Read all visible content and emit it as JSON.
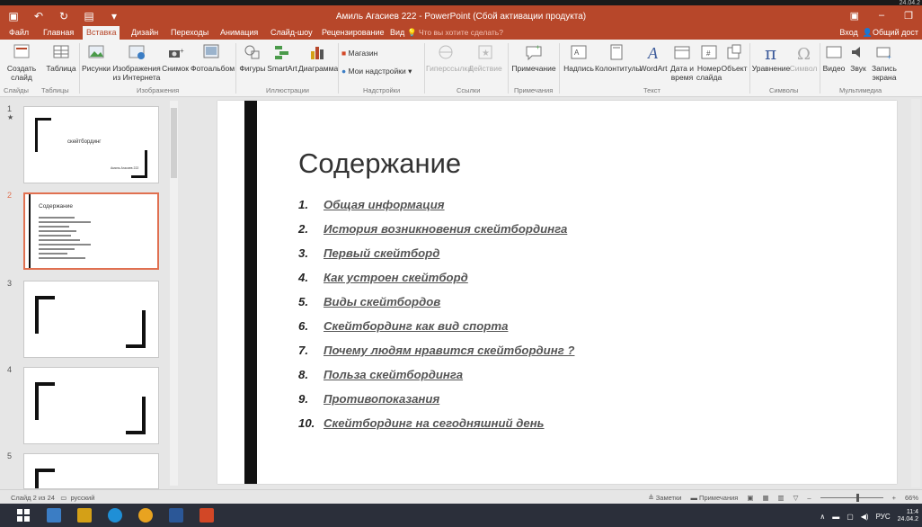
{
  "titlebar": {
    "title": "Амиль Агасиев 222 - PowerPoint (Сбой активации продукта)",
    "corner_date": "24.04.2"
  },
  "tabs": [
    "Файл",
    "Главная",
    "Вставка",
    "Дизайн",
    "Переходы",
    "Анимация",
    "Слайд-шоу",
    "Рецензирование",
    "Вид"
  ],
  "active_tab": "Вставка",
  "tell_me": "Что вы хотите сделать?",
  "account": {
    "signin": "Вход",
    "share": "Общий дост"
  },
  "ribbon": {
    "buttons": [
      {
        "label": "Создать слайд"
      },
      {
        "label": "Таблица"
      },
      {
        "label": "Рисунки"
      },
      {
        "label": "Изображения из Интернета"
      },
      {
        "label": "Снимок"
      },
      {
        "label": "Фотоальбом"
      },
      {
        "label": "Фигуры"
      },
      {
        "label": "SmartArt"
      },
      {
        "label": "Диаграмма"
      },
      {
        "label": "Магазин"
      },
      {
        "label": "Мои надстройки"
      },
      {
        "label": "Гиперссылка"
      },
      {
        "label": "Действие"
      },
      {
        "label": "Примечание"
      },
      {
        "label": "Надпись"
      },
      {
        "label": "Колонтитулы"
      },
      {
        "label": "WordArt"
      },
      {
        "label": "Дата и время"
      },
      {
        "label": "Номер слайда"
      },
      {
        "label": "Объект"
      },
      {
        "label": "Уравнение"
      },
      {
        "label": "Символ"
      },
      {
        "label": "Видео"
      },
      {
        "label": "Звук"
      },
      {
        "label": "Запись экрана"
      }
    ],
    "groups": [
      "Слайды",
      "Таблицы",
      "Изображения",
      "Иллюстрации",
      "Надстройки",
      "Ссылки",
      "Примечания",
      "Текст",
      "Символы",
      "Мультимедиа"
    ]
  },
  "thumbnails": [
    {
      "num": "1",
      "title": "скейтбординг",
      "subtitle": "Амиль Агасиев 222"
    },
    {
      "num": "2",
      "title": "Содержание"
    },
    {
      "num": "3"
    },
    {
      "num": "4"
    },
    {
      "num": "5"
    }
  ],
  "slide": {
    "title": "Содержание",
    "items": [
      {
        "n": "1.",
        "text": "Общая информация"
      },
      {
        "n": "2.",
        "text": "История возникновения скейтбординга"
      },
      {
        "n": "3.",
        "text": "Первый скейтборд"
      },
      {
        "n": "4.",
        "text": "Как устроен скейтборд"
      },
      {
        "n": "5.",
        "text": "Виды скейтбордов"
      },
      {
        "n": "6.",
        "text": "Скейтбординг как вид спорта"
      },
      {
        "n": "7.",
        "text": "Почему людям нравится скейтбординг ?"
      },
      {
        "n": "8.",
        "text": "Польза скейтбординга"
      },
      {
        "n": "9.",
        "text": "Противопоказания"
      },
      {
        "n": "10.",
        "text": "Скейтбординг на сегодняшний день"
      }
    ]
  },
  "status": {
    "slide_info": "Слайд 2 из 24",
    "language": "русский",
    "notes": "Заметки",
    "comments": "Примечания",
    "zoom": "66%"
  },
  "taskbar": {
    "lang": "РУС",
    "time": "11:4",
    "date": "24.04.2"
  },
  "colors": {
    "accent": "#b7472a",
    "selection": "#e07050"
  }
}
